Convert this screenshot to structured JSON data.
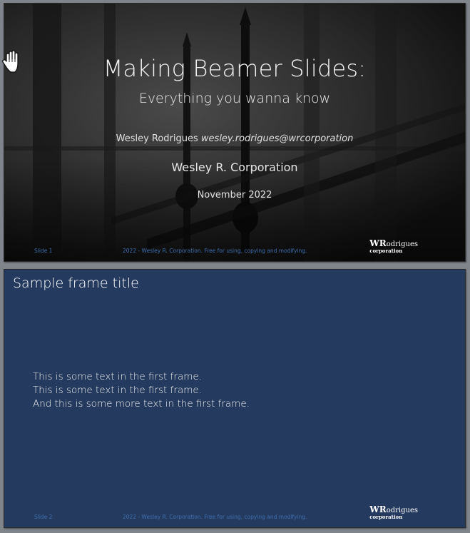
{
  "slides": [
    {
      "title": "Making Beamer Slides:",
      "subtitle": "Everything you wanna know",
      "author": "Wesley Rodrigues",
      "email": "wesley.rodrigues@wrcorporation",
      "institute": "Wesley R. Corporation",
      "date": "November 2022",
      "footer_slide": "Slide 1",
      "footer_note": "2022 - Wesley R. Corporation. Free for using, copying and modifying."
    },
    {
      "frame_title": "Sample frame title",
      "lines": [
        "This is some text in the first frame.",
        "This is some text in the first frame.",
        "And this is some more text in the first frame."
      ],
      "footer_slide": "Slide 2",
      "footer_note": "2022 - Wesley R. Corporation. Free for using, copying and modifying."
    }
  ],
  "logo": {
    "initials": "WR",
    "rest": "odrigues",
    "line2": "corporation"
  },
  "cursor": "hand-cursor-icon",
  "colors": {
    "slide2_background": "#243a5e",
    "footer_text": "#3f6fb0"
  }
}
